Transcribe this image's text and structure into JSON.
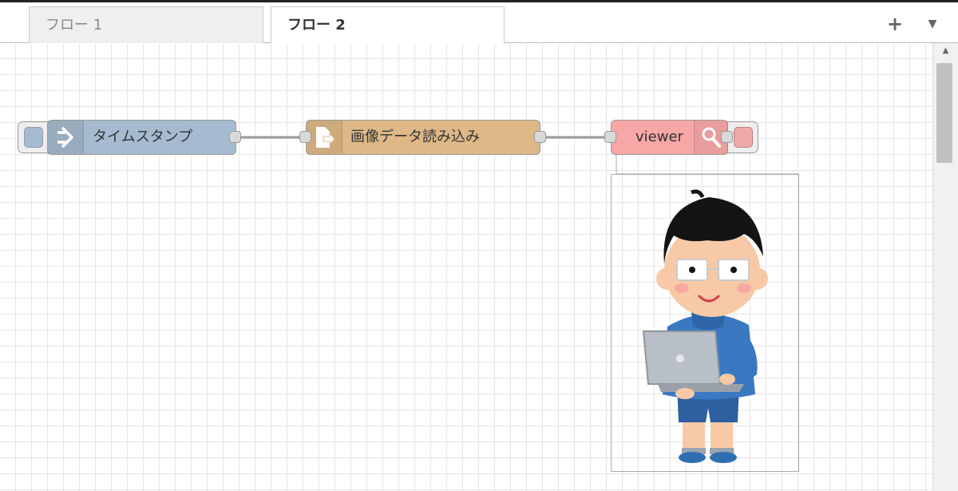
{
  "tabs": [
    {
      "label": "フロー 1",
      "active": false
    },
    {
      "label": "フロー 2",
      "active": true
    }
  ],
  "tab_actions": {
    "add_icon": "plus-icon",
    "menu_icon": "chevron-down-icon"
  },
  "nodes": [
    {
      "type": "inject",
      "label": "タイムスタンプ",
      "color": "#a6bbcf",
      "icon": "arrow-in-icon"
    },
    {
      "type": "file-in",
      "label": "画像データ読み込み",
      "color": "#deb887",
      "icon": "file-in-icon"
    },
    {
      "type": "image-viewer",
      "label": "viewer",
      "color": "#f8a7a7",
      "icon": "magnifier-icon"
    }
  ],
  "preview": {
    "content": "illustration of a person with glasses holding a laptop"
  },
  "colors": {
    "grid": "#e6e6e6",
    "wire": "#999999",
    "active_tab": "#ffffff",
    "inactive_tab": "#efefef"
  }
}
